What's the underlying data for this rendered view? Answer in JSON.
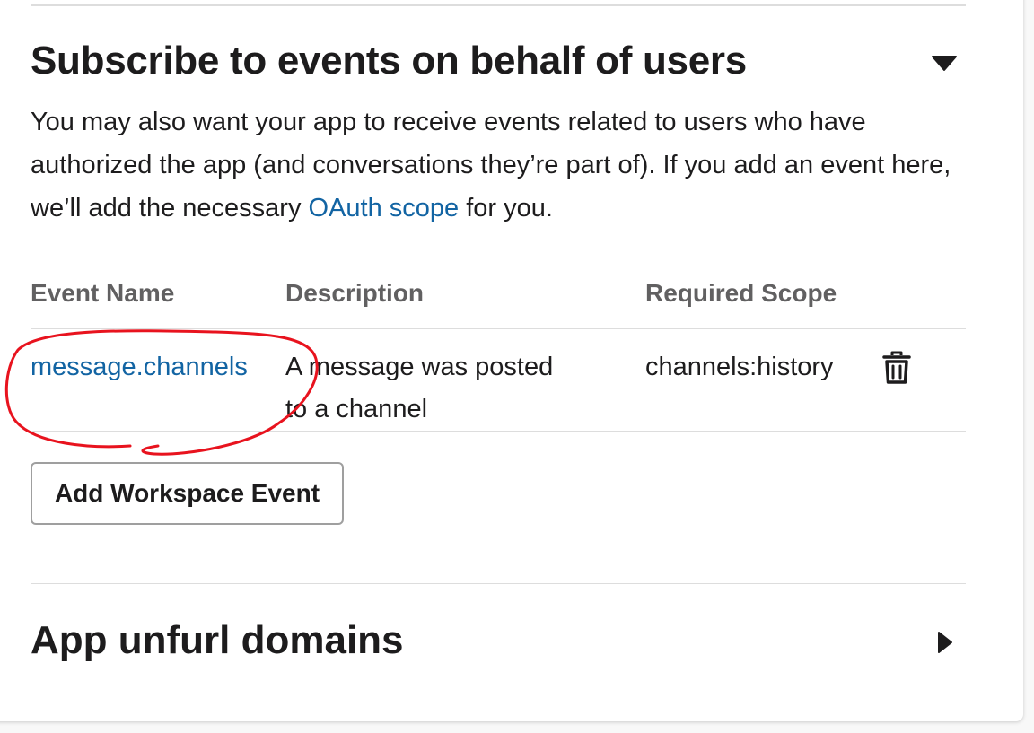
{
  "subscribe_section": {
    "title": "Subscribe to events on behalf of users",
    "expanded_icon": "caret-down-icon",
    "intro_before_link": "You may also want your app to receive events related to users who have authorized the app (and conversations they’re part of). If you add an event here, we’ll add the necessary ",
    "intro_link": "OAuth scope",
    "intro_after_link": " for you.",
    "table": {
      "headers": [
        "Event Name",
        "Description",
        "Required Scope"
      ],
      "rows": [
        {
          "event_name": "message.channels",
          "description": "A message was posted to a channel",
          "required_scope": "channels:history",
          "delete_icon": "trash-icon"
        }
      ]
    },
    "add_button_label": "Add Workspace Event"
  },
  "unfurl_section": {
    "title": "App unfurl domains",
    "collapsed_icon": "caret-right-icon"
  },
  "colors": {
    "link": "#1264a3",
    "header_text": "#616061",
    "annotation": "#e8131e"
  }
}
